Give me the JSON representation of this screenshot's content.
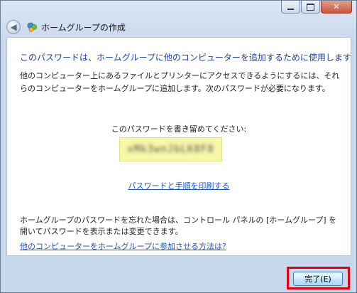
{
  "window": {
    "title": "ホームグループの作成",
    "caption_buttons": {
      "minimize_icon": "minimize-icon",
      "maximize_icon": "maximize-icon",
      "close_glyph": "✕"
    }
  },
  "nav": {
    "back_icon": "back-arrow-icon",
    "app_icon": "homegroup-icon",
    "back_glyph": "◀"
  },
  "content": {
    "heading": "このパスワードは、ホームグループに他のコンピューターを追加するために使用します",
    "description": "他のコンピューター上にあるファイルとプリンターにアクセスできるようにするには、それらのコンピューターをホームグループに追加します。次のパスワードが必要になります。",
    "password_prompt": "このパスワードを書き留めてください:",
    "password_value": "xMk3wnJbLK8F8",
    "print_link": "パスワードと手順を印刷する",
    "note": "ホームグループのパスワードを忘れた場合は、コントロール パネルの [ホームグループ] を開いてパスワードを表示または変更できます。",
    "help_link": "他のコンピューターをホームグループに参加させる方法は?"
  },
  "footer": {
    "finish_label": "完了(E)"
  },
  "colors": {
    "heading": "#1e3fa8",
    "link": "#1a55c8",
    "password_bg": "#f7f7a8",
    "highlight": "#e60012"
  }
}
